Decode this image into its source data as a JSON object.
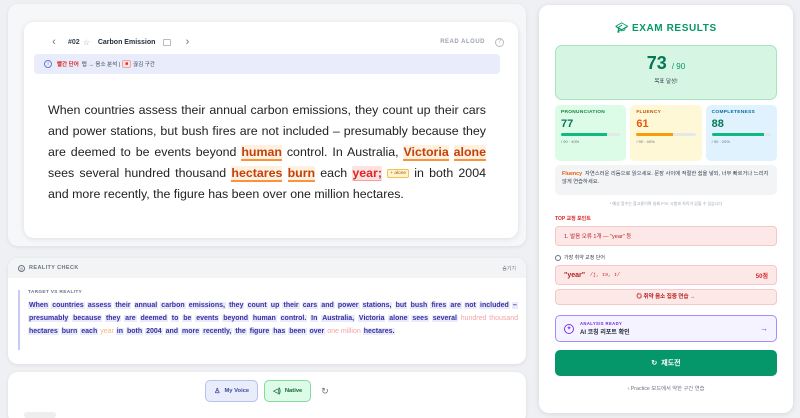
{
  "question": {
    "number": "#02",
    "title": "Carbon Emission",
    "read_aloud": "READ ALOUD",
    "prev_icon": "chevron-left-icon",
    "next_icon": "chevron-right-icon"
  },
  "legend": {
    "red_label": "빨간 단어",
    "middle": "탭 → 음소 분석 |",
    "pill": "■",
    "tail": "끊김 구간"
  },
  "passage": {
    "t1": "When countries assess their annual carbon emissions, they count up their cars and power stations, but bush fires are not included – presumably because they are deemed to be events beyond ",
    "human": "human",
    "t2": " control. In Australia, ",
    "victoria": "Victoria",
    "alone": "alone",
    "t3": " sees several hundred thousand ",
    "hectares": "hectares",
    "burn": "burn",
    "t4": " each ",
    "year": "year;",
    "alone_chip": "+ alone",
    "t5": " in both 2004 and more recently, the figure has been over one million hectares."
  },
  "reality": {
    "title": "REALITY CHECK",
    "hide": "숨기기",
    "label": "TARGET VS REALITY",
    "words": [
      {
        "w": "When",
        "s": "ok"
      },
      {
        "w": "countries",
        "s": "ok"
      },
      {
        "w": "assess",
        "s": "ok"
      },
      {
        "w": "their",
        "s": "ok"
      },
      {
        "w": "annual",
        "s": "ok"
      },
      {
        "w": "carbon",
        "s": "ok"
      },
      {
        "w": "emissions,",
        "s": "ok"
      },
      {
        "w": "they",
        "s": "ok"
      },
      {
        "w": "count",
        "s": "ok"
      },
      {
        "w": "up",
        "s": "ok"
      },
      {
        "w": "their",
        "s": "ok"
      },
      {
        "w": "cars",
        "s": "ok"
      },
      {
        "w": "and",
        "s": "ok"
      },
      {
        "w": "power",
        "s": "ok"
      },
      {
        "w": "stations,",
        "s": "ok"
      },
      {
        "w": "but",
        "s": "ok"
      },
      {
        "w": "bush",
        "s": "ok"
      },
      {
        "w": "fires",
        "s": "ok"
      },
      {
        "w": "are",
        "s": "ok"
      },
      {
        "w": "not",
        "s": "ok"
      },
      {
        "w": "included",
        "s": "ok"
      },
      {
        "w": "–",
        "s": "ok"
      },
      {
        "w": "presumably",
        "s": "ok"
      },
      {
        "w": "because",
        "s": "ok"
      },
      {
        "w": "they",
        "s": "ok"
      },
      {
        "w": "are",
        "s": "ok"
      },
      {
        "w": "deemed",
        "s": "ok"
      },
      {
        "w": "to",
        "s": "ok"
      },
      {
        "w": "be",
        "s": "ok"
      },
      {
        "w": "events",
        "s": "ok"
      },
      {
        "w": "beyond",
        "s": "ok"
      },
      {
        "w": "human",
        "s": "ok"
      },
      {
        "w": "control.",
        "s": "ok"
      },
      {
        "w": "In",
        "s": "ok"
      },
      {
        "w": "Australia,",
        "s": "ok"
      },
      {
        "w": "Victoria",
        "s": "ok"
      },
      {
        "w": "alone",
        "s": "ok"
      },
      {
        "w": "sees",
        "s": "ok"
      },
      {
        "w": "several",
        "s": "ok"
      },
      {
        "w": "hundred",
        "s": "miss"
      },
      {
        "w": "thousand",
        "s": "miss"
      },
      {
        "w": "hectares",
        "s": "ok"
      },
      {
        "w": "burn",
        "s": "ok"
      },
      {
        "w": "each",
        "s": "ok"
      },
      {
        "w": "year",
        "s": "warn"
      },
      {
        "w": "in",
        "s": "ok"
      },
      {
        "w": "both",
        "s": "ok"
      },
      {
        "w": "2004",
        "s": "ok"
      },
      {
        "w": "and",
        "s": "ok"
      },
      {
        "w": "more",
        "s": "ok"
      },
      {
        "w": "recently,",
        "s": "ok"
      },
      {
        "w": "the",
        "s": "ok"
      },
      {
        "w": "figure",
        "s": "ok"
      },
      {
        "w": "has",
        "s": "ok"
      },
      {
        "w": "been",
        "s": "ok"
      },
      {
        "w": "over",
        "s": "ok"
      },
      {
        "w": "one",
        "s": "miss"
      },
      {
        "w": "million",
        "s": "miss"
      },
      {
        "w": "hectares.",
        "s": "ok"
      }
    ]
  },
  "voice": {
    "my_voice": "My Voice",
    "native": "Native"
  },
  "results": {
    "title": "EXAM RESULTS",
    "score": "73",
    "score_of": "/ 90",
    "score_note": "목표 달성!",
    "metrics": [
      {
        "label": "PRONUNCIATION",
        "value": "77",
        "fraction": 0.77,
        "range": "/ 90 · 40%"
      },
      {
        "label": "FLUENCY",
        "value": "61",
        "fraction": 0.61,
        "range": "/ 90 · 40%"
      },
      {
        "label": "COMPLETENESS",
        "value": "88",
        "fraction": 0.88,
        "range": "/ 90 · 20%"
      }
    ],
    "feedback_label": "Fluency",
    "feedback_text": "자연스러운 리듬으로 읽으세요. 문장 사이에 적절한 쉼을 넣되, 너무 빠르거나 느리지 않게 연습하세요.",
    "disclaimer": "* 예상 점수는 참고용이며 실제 PTE 시험과 차이가 있을 수 있습니다",
    "top_label": "TOP 교정 포인트",
    "top_error": "1.  발음 오류 1개 — \"year\" 등",
    "weak_label": "가장 취약 교정 단어",
    "weak_word": "\"year\"",
    "weak_ipa": "/j, ɪə, ɪ/",
    "weak_score": "50점",
    "drill": "◎ 취약 음소 집중 연습 →",
    "analysis_kicker": "ANALYSIS READY",
    "analysis_title": "AI 코칭 리포트 확인",
    "retry": "재도전",
    "practice": "‹  Practice 모드에서 약한 구간 연습"
  }
}
